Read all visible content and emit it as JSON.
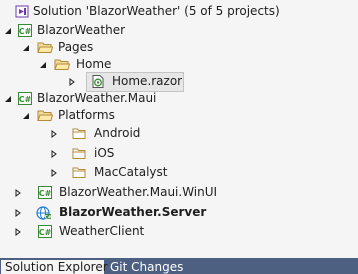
{
  "panel": {
    "title": "Solution Explorer"
  },
  "tree": {
    "solution": {
      "label": "Solution 'BlazorWeather' (5 of 5 projects)",
      "icon": "solution-icon"
    },
    "items": [
      {
        "id": "blazorweather",
        "label": "BlazorWeather",
        "icon": "csharp-project-icon",
        "expanded": true
      },
      {
        "id": "pages",
        "label": "Pages",
        "icon": "folder-open-icon",
        "expanded": true
      },
      {
        "id": "home",
        "label": "Home",
        "icon": "folder-open-icon",
        "expanded": true
      },
      {
        "id": "home-razor",
        "label": "Home.razor",
        "icon": "razor-file-icon",
        "expanded": false,
        "selected": true
      },
      {
        "id": "maui",
        "label": "BlazorWeather.Maui",
        "icon": "csharp-project-icon",
        "expanded": true
      },
      {
        "id": "platforms",
        "label": "Platforms",
        "icon": "folder-open-icon",
        "expanded": true
      },
      {
        "id": "android",
        "label": "Android",
        "icon": "folder-icon",
        "expanded": false
      },
      {
        "id": "ios",
        "label": "iOS",
        "icon": "folder-icon",
        "expanded": false
      },
      {
        "id": "maccatalyst",
        "label": "MacCatalyst",
        "icon": "folder-icon",
        "expanded": false
      },
      {
        "id": "winui",
        "label": "BlazorWeather.Maui.WinUI",
        "icon": "csharp-project-icon",
        "expanded": false
      },
      {
        "id": "server",
        "label": "BlazorWeather.Server",
        "icon": "web-project-icon",
        "expanded": false,
        "bold": true
      },
      {
        "id": "weatherclient",
        "label": "WeatherClient",
        "icon": "csharp-project-icon",
        "expanded": false
      }
    ]
  },
  "tabs": [
    {
      "label": "Solution Explorer",
      "active": true
    },
    {
      "label": "Git Changes",
      "active": false
    }
  ],
  "colors": {
    "background": "#f5f5f5",
    "tabbar": "#4d6082",
    "selection": "#e6e6e6",
    "csharp_green": "#388a34",
    "folder": "#dcb67a",
    "web_blue": "#1e7ad4"
  }
}
